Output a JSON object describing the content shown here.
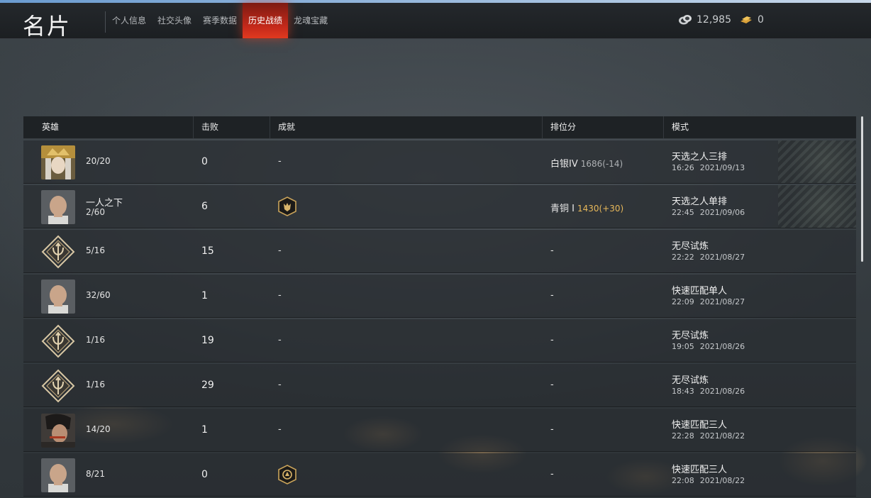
{
  "header": {
    "title": "名片",
    "tabs": [
      {
        "label": "个人信息",
        "active": false
      },
      {
        "label": "社交头像",
        "active": false
      },
      {
        "label": "赛季数据",
        "active": false
      },
      {
        "label": "历史战绩",
        "active": true
      },
      {
        "label": "龙魂宝藏",
        "active": false
      }
    ],
    "currencies": [
      {
        "icon": "coin-stack-icon",
        "value": "12,985"
      },
      {
        "icon": "gold-ingot-icon",
        "value": "0"
      }
    ]
  },
  "table": {
    "columns": {
      "hero": "英雄",
      "kills": "击败",
      "achievement": "成就",
      "rank": "排位分",
      "mode": "模式"
    },
    "rows": [
      {
        "avatar": "hero-gold-crown-avatar",
        "hero_name": "",
        "hero_stat": "20/20",
        "kills": "0",
        "achievement": "-",
        "achievement_badge": false,
        "rank_tier": "白银IV",
        "rank_points": "1686(-14)",
        "rank_up": false,
        "mode": "天选之人三排",
        "time": "16:26",
        "date": "2021/09/13",
        "deco": true
      },
      {
        "avatar": "hero-shaved-head-avatar",
        "hero_name": "一人之下",
        "hero_stat": "2/60",
        "kills": "6",
        "achievement": "",
        "achievement_badge": true,
        "rank_tier": "青铜 I",
        "rank_points": "1430(+30)",
        "rank_up": true,
        "mode": "天选之人单排",
        "time": "22:45",
        "date": "2021/09/06",
        "deco": true
      },
      {
        "avatar": "trident-emblem-avatar",
        "hero_name": "",
        "hero_stat": "5/16",
        "kills": "15",
        "achievement": "-",
        "achievement_badge": false,
        "rank_tier": "-",
        "rank_points": "",
        "rank_up": false,
        "mode": "无尽试炼",
        "time": "22:22",
        "date": "2021/08/27",
        "deco": false
      },
      {
        "avatar": "hero-shaved-head-avatar",
        "hero_name": "",
        "hero_stat": "32/60",
        "kills": "1",
        "achievement": "-",
        "achievement_badge": false,
        "rank_tier": "-",
        "rank_points": "",
        "rank_up": false,
        "mode": "快速匹配单人",
        "time": "22:09",
        "date": "2021/08/27",
        "deco": false
      },
      {
        "avatar": "trident-emblem-avatar",
        "hero_name": "",
        "hero_stat": "1/16",
        "kills": "19",
        "achievement": "-",
        "achievement_badge": false,
        "rank_tier": "-",
        "rank_points": "",
        "rank_up": false,
        "mode": "无尽试炼",
        "time": "19:05",
        "date": "2021/08/26",
        "deco": false
      },
      {
        "avatar": "trident-emblem-avatar",
        "hero_name": "",
        "hero_stat": "1/16",
        "kills": "29",
        "achievement": "-",
        "achievement_badge": false,
        "rank_tier": "-",
        "rank_points": "",
        "rank_up": false,
        "mode": "无尽试炼",
        "time": "18:43",
        "date": "2021/08/26",
        "deco": false
      },
      {
        "avatar": "hero-red-eyed-avatar",
        "hero_name": "",
        "hero_stat": "14/20",
        "kills": "1",
        "achievement": "-",
        "achievement_badge": false,
        "rank_tier": "-",
        "rank_points": "",
        "rank_up": false,
        "mode": "快速匹配三人",
        "time": "22:28",
        "date": "2021/08/22",
        "deco": false
      },
      {
        "avatar": "hero-shaved-head-avatar",
        "hero_name": "",
        "hero_stat": "8/21",
        "kills": "0",
        "achievement": "",
        "achievement_badge": true,
        "rank_tier": "-",
        "rank_points": "",
        "rank_up": false,
        "mode": "快速匹配三人",
        "time": "22:08",
        "date": "2021/08/22",
        "deco": false
      }
    ]
  },
  "colors": {
    "accent": "#d2301d",
    "gold": "#e8b85a",
    "header_bg": "#1e2225"
  }
}
